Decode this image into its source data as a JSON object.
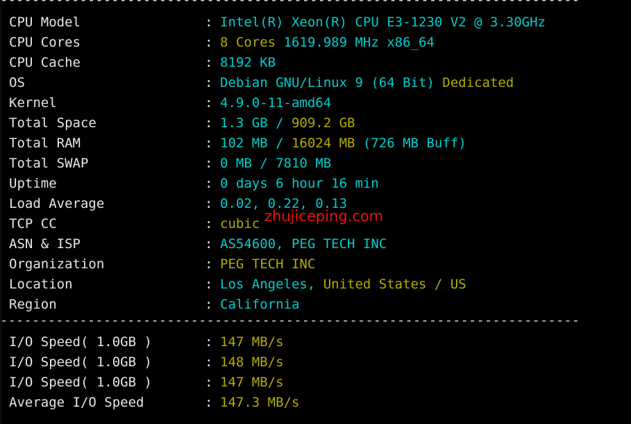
{
  "terminal": {
    "background_color": "#000000",
    "label_color": "#e6e6e6",
    "cyan_color": "#00cdcd",
    "yellow_color": "#b3ac00",
    "watermark_color": "#f01010",
    "separator_top": "-------------------------------------------------------------------------",
    "separator_mid": "-------------------------------------------------------------------------",
    "colon": ":"
  },
  "watermark": {
    "text": "zhujiceping.com"
  },
  "info_rows": [
    {
      "label": "CPU Model",
      "segments": [
        {
          "text": "Intel(R) Xeon(R) CPU E3-1230 V2 @ 3.30GHz",
          "color": "cyan"
        }
      ]
    },
    {
      "label": "CPU Cores",
      "segments": [
        {
          "text": "8 Cores",
          "color": "yellow"
        },
        {
          "text": " 1619.989 MHz x86_64",
          "color": "cyan"
        }
      ]
    },
    {
      "label": "CPU Cache",
      "segments": [
        {
          "text": "8192 KB",
          "color": "cyan"
        }
      ]
    },
    {
      "label": "OS",
      "segments": [
        {
          "text": "Debian GNU/Linux 9 (64 Bit) ",
          "color": "cyan"
        },
        {
          "text": "Dedicated",
          "color": "yellow"
        }
      ]
    },
    {
      "label": "Kernel",
      "segments": [
        {
          "text": "4.9.0-11-amd64",
          "color": "cyan"
        }
      ]
    },
    {
      "label": "Total Space",
      "segments": [
        {
          "text": "1.3 GB",
          "color": "cyan"
        },
        {
          "text": " / ",
          "color": "cyan"
        },
        {
          "text": "909.2 GB",
          "color": "yellow"
        }
      ]
    },
    {
      "label": "Total RAM",
      "segments": [
        {
          "text": "102 MB",
          "color": "cyan"
        },
        {
          "text": " / ",
          "color": "cyan"
        },
        {
          "text": "16024 MB",
          "color": "yellow"
        },
        {
          "text": " (726 MB Buff)",
          "color": "cyan"
        }
      ]
    },
    {
      "label": "Total SWAP",
      "segments": [
        {
          "text": "0 MB / 7810 MB",
          "color": "cyan"
        }
      ]
    },
    {
      "label": "Uptime",
      "segments": [
        {
          "text": "0 days 6 hour 16 min",
          "color": "cyan"
        }
      ]
    },
    {
      "label": "Load Average",
      "segments": [
        {
          "text": "0.02, 0.22, 0.13",
          "color": "cyan"
        }
      ]
    },
    {
      "label": "TCP CC",
      "segments": [
        {
          "text": "cubic",
          "color": "yellow"
        }
      ]
    },
    {
      "label": "ASN & ISP",
      "segments": [
        {
          "text": "AS54600, PEG TECH INC",
          "color": "cyan"
        }
      ]
    },
    {
      "label": "Organization",
      "segments": [
        {
          "text": "PEG TECH INC",
          "color": "yellow"
        }
      ]
    },
    {
      "label": "Location",
      "segments": [
        {
          "text": "Los Angeles, ",
          "color": "cyan"
        },
        {
          "text": "United States / US",
          "color": "yellow"
        }
      ]
    },
    {
      "label": "Region",
      "segments": [
        {
          "text": "California",
          "color": "cyan"
        }
      ]
    }
  ],
  "io_rows": [
    {
      "label": "I/O Speed( 1.0GB )",
      "segments": [
        {
          "text": "147 MB/s",
          "color": "yellow"
        }
      ]
    },
    {
      "label": "I/O Speed( 1.0GB )",
      "segments": [
        {
          "text": "148 MB/s",
          "color": "yellow"
        }
      ]
    },
    {
      "label": "I/O Speed( 1.0GB )",
      "segments": [
        {
          "text": "147 MB/s",
          "color": "yellow"
        }
      ]
    },
    {
      "label": "Average I/O Speed",
      "segments": [
        {
          "text": "147.3 MB/s",
          "color": "yellow"
        }
      ]
    }
  ]
}
